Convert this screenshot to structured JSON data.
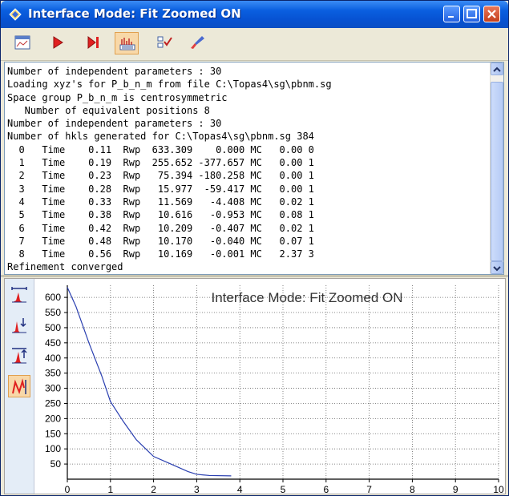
{
  "window": {
    "title": "Interface Mode: Fit Zoomed ON"
  },
  "toolbar": {
    "icons": [
      "graph-window-icon",
      "run-icon",
      "step-icon",
      "plot-icon",
      "checklist-icon",
      "brush-icon"
    ]
  },
  "console": {
    "lines": [
      "Number of independent parameters : 30",
      "Loading xyz's for P_b_n_m from file C:\\Topas4\\sg\\pbnm.sg",
      "Space group P_b_n_m is centrosymmetric",
      "   Number of equivalent positions 8",
      "Number of independent parameters : 30",
      "Number of hkls generated for C:\\Topas4\\sg\\pbnm.sg 384",
      "  0   Time    0.11  Rwp  633.309    0.000 MC   0.00 0",
      "  1   Time    0.19  Rwp  255.652 -377.657 MC   0.00 1",
      "  2   Time    0.23  Rwp   75.394 -180.258 MC   0.00 1",
      "  3   Time    0.28  Rwp   15.977  -59.417 MC   0.00 1",
      "  4   Time    0.33  Rwp   11.569   -4.408 MC   0.02 1",
      "  5   Time    0.38  Rwp   10.616   -0.953 MC   0.08 1",
      "  6   Time    0.42  Rwp   10.209   -0.407 MC   0.02 1",
      "  7   Time    0.48  Rwp   10.170   -0.040 MC   0.07 1",
      "  8   Time    0.56  Rwp   10.169   -0.001 MC   2.37 3",
      "Refinement converged"
    ]
  },
  "chart_data": {
    "type": "line",
    "title": "Interface Mode: Fit Zoomed ON",
    "x": [
      0,
      0.2,
      0.5,
      0.8,
      1,
      1.3,
      1.6,
      2,
      2.4,
      2.8,
      3,
      3.3,
      3.8
    ],
    "y": [
      633,
      570,
      450,
      340,
      256,
      190,
      130,
      75,
      50,
      25,
      16,
      12,
      11
    ],
    "xlim": [
      0,
      10
    ],
    "ylim": [
      0,
      640
    ],
    "xticks": [
      0,
      1,
      2,
      3,
      4,
      5,
      6,
      7,
      8,
      9,
      10
    ],
    "yticks": [
      50,
      100,
      150,
      200,
      250,
      300,
      350,
      400,
      450,
      500,
      550,
      600
    ],
    "grid": true,
    "line_color": "#2a3fb0"
  },
  "sidebar": {
    "icons": [
      "fit-width-icon",
      "zoom-down-icon",
      "zoom-up-icon",
      "fit-curve-icon"
    ]
  }
}
